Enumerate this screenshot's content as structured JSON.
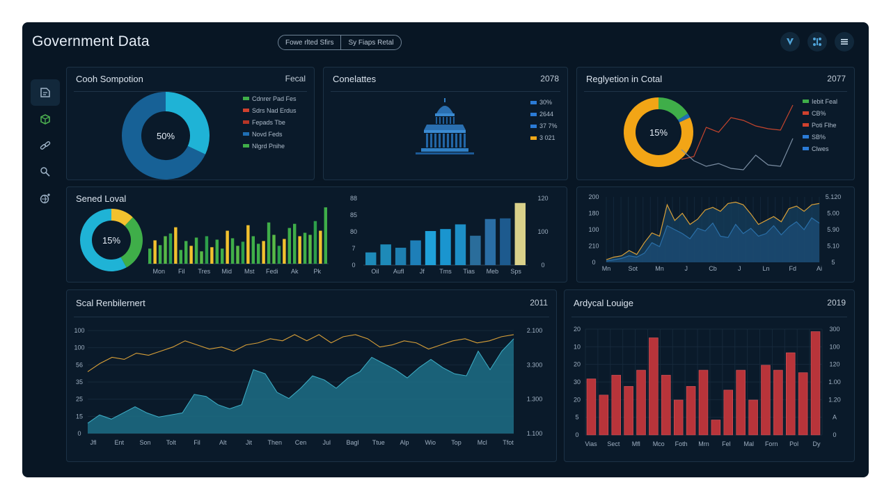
{
  "app": {
    "title": "Government Data",
    "filters": [
      "Fowe rlted Sfirs",
      "Sy Fiaps Retal"
    ],
    "top_icons": [
      "shield-icon",
      "network-icon",
      "menu-icon"
    ]
  },
  "sidebar": {
    "items": [
      {
        "icon": "document-icon",
        "active": true
      },
      {
        "icon": "cube-icon",
        "active": false,
        "color": "#4caf50"
      },
      {
        "icon": "link-icon",
        "active": false
      },
      {
        "icon": "pin-icon",
        "active": false
      },
      {
        "icon": "globe-icon",
        "active": false
      }
    ]
  },
  "panels": {
    "p1": {
      "title": "Cooh Sompotion",
      "value": "Fecal",
      "legend": [
        {
          "label": "Cdnrer Pad Fes",
          "color": "#3fae49"
        },
        {
          "label": "Sdrs Nad Erdus",
          "color": "#d0412e"
        },
        {
          "label": "Fepads Tbe",
          "color": "#b53527"
        },
        {
          "label": "Novd Feds",
          "color": "#1f6fb4"
        },
        {
          "label": "Nlgrd Pnihe",
          "color": "#3fae49"
        }
      ]
    },
    "p2": {
      "title": "Conelattes",
      "value": "2078",
      "legend": [
        {
          "label": "30%",
          "color": "#2b7bd6"
        },
        {
          "label": "2644",
          "color": "#2b7bd6"
        },
        {
          "label": "37 7%",
          "color": "#2b7bd6"
        },
        {
          "label": "3 021",
          "color": "#f0a818"
        }
      ]
    },
    "p3": {
      "title": "Reglyetion in Cotal",
      "value": "2077",
      "legend": [
        {
          "label": "Iebit Feal",
          "color": "#3fae49"
        },
        {
          "label": "CB%",
          "color": "#d0412e"
        },
        {
          "label": "Poti Flhe",
          "color": "#d0412e"
        },
        {
          "label": "SB%",
          "color": "#2b7bd6"
        },
        {
          "label": "Clwes",
          "color": "#2b7bd6"
        }
      ]
    },
    "p4": {
      "title": "Sened Loval"
    },
    "p7": {
      "title": "Scal Renbilernert",
      "value": "2011"
    },
    "p8": {
      "title": "Ardycal Louige",
      "value": "2019"
    }
  },
  "chart_data": [
    {
      "id": "p1-donut",
      "type": "pie",
      "center_label": "50%",
      "values": [
        32,
        68
      ],
      "colors": [
        "#1fb3d6",
        "#176196"
      ]
    },
    {
      "id": "p3-donut",
      "type": "pie",
      "center_label": "15%",
      "values": [
        16,
        2,
        82
      ],
      "colors": [
        "#3fae49",
        "#1f6fb4",
        "#f2a516"
      ]
    },
    {
      "id": "p3-line",
      "type": "line",
      "series": [
        {
          "values": [
            16,
            20,
            62,
            55,
            76,
            72,
            64,
            60,
            58,
            94
          ],
          "color": "#c7452d"
        },
        {
          "values": [
            30,
            14,
            6,
            10,
            3,
            1,
            22,
            8,
            6,
            46
          ],
          "color": "#7b8ea3"
        }
      ]
    },
    {
      "id": "p4-donut",
      "type": "pie",
      "center_label": "15%",
      "values": [
        12,
        30,
        58
      ],
      "colors": [
        "#f2c12e",
        "#3fae49",
        "#1fb3d6"
      ]
    },
    {
      "id": "p4-bar",
      "type": "bar",
      "categories": [
        "Mon",
        "Fil",
        "Tres",
        "Mid",
        "Mst",
        "Fedi",
        "Ak",
        "Pk"
      ],
      "values": [
        22,
        34,
        27,
        40,
        44,
        53,
        20,
        33,
        26,
        38,
        18,
        40,
        24,
        35,
        22,
        48,
        37,
        26,
        32,
        56,
        40,
        29,
        33,
        60,
        42,
        26,
        36,
        52,
        58,
        40,
        45,
        42,
        62,
        48,
        82
      ]
    },
    {
      "id": "p5-bar",
      "type": "bar",
      "categories": [
        "Oil",
        "Aufl",
        "Jf",
        "Tms",
        "Tias",
        "Meb",
        "Sps"
      ],
      "y_ticks_left": [
        "88",
        "85",
        "80",
        "7",
        "0"
      ],
      "y_ticks_right": [
        "120",
        "100",
        "0"
      ],
      "values": [
        19,
        31,
        26,
        37,
        51,
        54,
        61,
        44,
        69,
        70,
        93
      ],
      "colors": [
        "#1e8ab8",
        "#1e8ab8",
        "#1e7fb0",
        "#1e7fb8",
        "#1fa1d9",
        "#1a95cf",
        "#1d8fc6",
        "#2a6d9b",
        "#2a6ea5",
        "#1d5a8e",
        "#d9d18a"
      ]
    },
    {
      "id": "p6-area",
      "type": "area",
      "x_ticks": [
        "Mn",
        "Sot",
        "Mn",
        "J",
        "Cb",
        "J",
        "Ln",
        "Fd",
        "Ai"
      ],
      "y_ticks_left": [
        "200",
        "180",
        "100",
        "210",
        "0"
      ],
      "y_ticks_right": [
        "5.120",
        "5.00",
        "5.90",
        "5.10",
        "5"
      ],
      "series": [
        {
          "values": [
            4,
            8,
            10,
            18,
            12,
            30,
            45,
            40,
            88,
            64,
            75,
            58,
            66,
            80,
            84,
            78,
            90,
            92,
            88,
            74,
            58,
            64,
            70,
            62,
            82,
            86,
            78,
            88,
            90
          ],
          "color": "#d9a038"
        },
        {
          "values": [
            2,
            4,
            6,
            10,
            8,
            14,
            30,
            24,
            56,
            50,
            44,
            36,
            52,
            48,
            60,
            40,
            38,
            58,
            44,
            52,
            40,
            44,
            56,
            42,
            54,
            62,
            50,
            68,
            60
          ],
          "color": "#2a6fa8"
        }
      ]
    },
    {
      "id": "p7-area",
      "type": "area",
      "x_ticks": [
        "Jfl",
        "Ent",
        "Son",
        "Tolt",
        "Fil",
        "Alt",
        "Jit",
        "Then",
        "Cen",
        "Jul",
        "Bagl",
        "Ttue",
        "Alp",
        "Wio",
        "Top",
        "Mcl",
        "Tfot"
      ],
      "y_ticks_left": [
        "100",
        "100",
        "56",
        "35",
        "25",
        "15",
        "0"
      ],
      "y_ticks_right": [
        "2.100",
        "3.300",
        "1.300",
        "1.100"
      ],
      "series": [
        {
          "name": "line",
          "values": [
            60,
            68,
            74,
            72,
            78,
            76,
            80,
            84,
            90,
            86,
            82,
            84,
            80,
            86,
            88,
            92,
            90,
            96,
            90,
            96,
            88,
            94,
            96,
            92,
            84,
            86,
            90,
            88,
            82,
            86,
            90,
            92,
            88,
            90,
            94,
            96
          ],
          "color": "#d9a038"
        },
        {
          "name": "area",
          "values": [
            10,
            18,
            14,
            20,
            26,
            20,
            16,
            18,
            20,
            38,
            36,
            28,
            24,
            28,
            62,
            58,
            40,
            34,
            44,
            56,
            52,
            44,
            54,
            60,
            74,
            68,
            62,
            54,
            64,
            72,
            64,
            58,
            56,
            80,
            62,
            80,
            92
          ],
          "color": "#1d6f86"
        }
      ]
    },
    {
      "id": "p8-bar",
      "type": "bar",
      "categories": [
        "Vias",
        "Sect",
        "Mfl",
        "Mco",
        "Foth",
        "Mrn",
        "Fel",
        "Mal",
        "Forn",
        "Pol",
        "Dy"
      ],
      "y_ticks_left": [
        "20",
        "10",
        "20",
        "30",
        "20",
        "5",
        "0"
      ],
      "y_ticks_right": [
        "300",
        "100",
        "120",
        "1.00",
        "1.20",
        "A",
        "0"
      ],
      "values": [
        45,
        32,
        48,
        39,
        52,
        78,
        48,
        28,
        39,
        52,
        12,
        36,
        52,
        28,
        56,
        52,
        66,
        50,
        83
      ]
    }
  ]
}
